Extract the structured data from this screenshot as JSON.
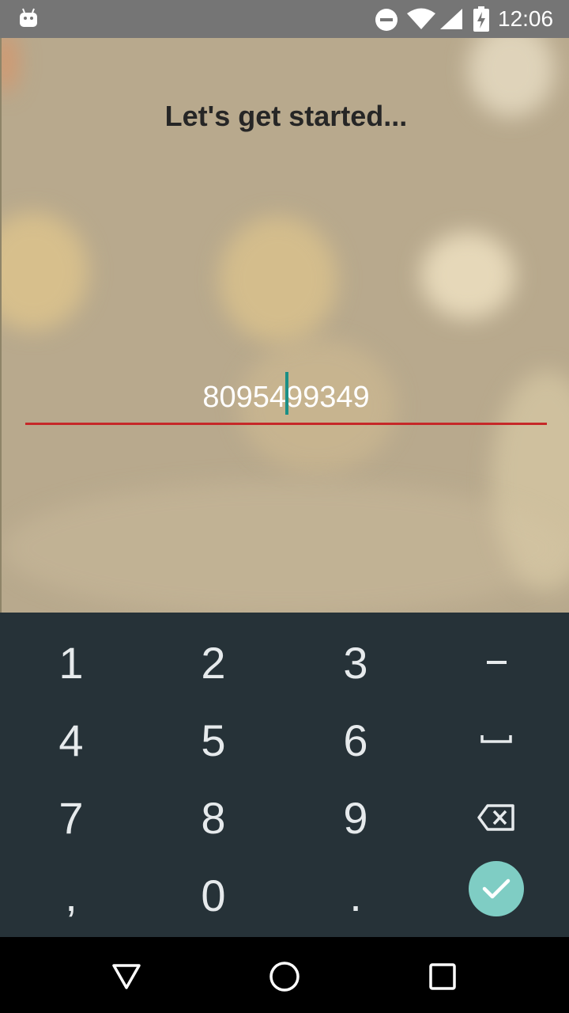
{
  "status_bar": {
    "time": "12:06",
    "icons": [
      "android-icon",
      "do-not-disturb-icon",
      "wifi-icon",
      "cell-signal-icon",
      "battery-charging-icon"
    ]
  },
  "screen": {
    "title": "Let's get started...",
    "phone_number": "8095499349"
  },
  "keyboard": {
    "keys": [
      {
        "label": "1"
      },
      {
        "label": "2"
      },
      {
        "label": "3"
      },
      {
        "label": "–"
      },
      {
        "label": "4"
      },
      {
        "label": "5"
      },
      {
        "label": "6"
      },
      {
        "label": "␣"
      },
      {
        "label": "7"
      },
      {
        "label": "8"
      },
      {
        "label": "9"
      },
      {
        "label": "⌫"
      },
      {
        "label": ","
      },
      {
        "label": "0"
      },
      {
        "label": "."
      },
      {
        "label": "✓"
      }
    ]
  },
  "colors": {
    "status_bar": "#757575",
    "background": "#b8a98d",
    "underline": "#c62828",
    "cursor": "#1a8f86",
    "keyboard": "#263238",
    "enter_button": "#7fcdc4"
  },
  "nav_bar": {
    "icons": [
      "back-icon",
      "home-icon",
      "recents-icon"
    ]
  }
}
